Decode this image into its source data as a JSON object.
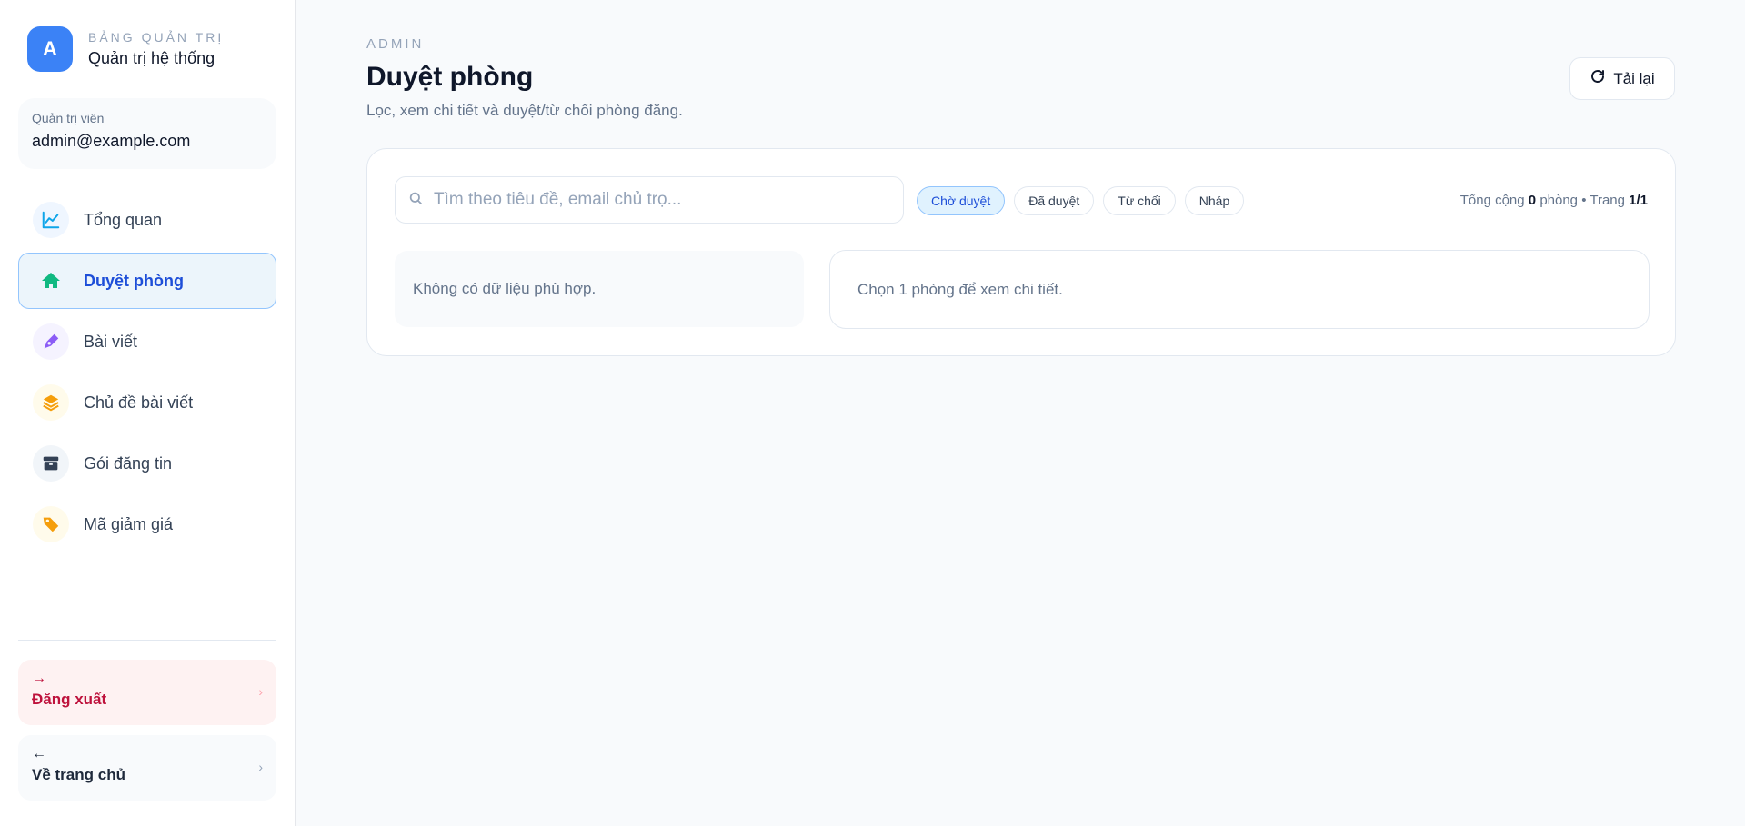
{
  "brand": {
    "avatar_letter": "A",
    "kicker": "BẢNG QUẢN TRỊ",
    "title": "Quản trị hệ thống"
  },
  "user": {
    "role": "Quản trị viên",
    "email": "admin@example.com"
  },
  "nav": [
    {
      "label": "Tổng quan",
      "icon": "chart-line-icon",
      "active": false
    },
    {
      "label": "Duyệt phòng",
      "icon": "home-icon",
      "active": true
    },
    {
      "label": "Bài viết",
      "icon": "pen-nib-icon",
      "active": false
    },
    {
      "label": "Chủ đề bài viết",
      "icon": "layers-icon",
      "active": false
    },
    {
      "label": "Gói đăng tin",
      "icon": "package-icon",
      "active": false
    },
    {
      "label": "Mã giảm giá",
      "icon": "tag-icon",
      "active": false
    }
  ],
  "bottom": {
    "logout": {
      "arrow": "→",
      "label": "Đăng xuất"
    },
    "home": {
      "arrow": "←",
      "label": "Về trang chủ"
    }
  },
  "header": {
    "kicker": "ADMIN",
    "title": "Duyệt phòng",
    "subtitle": "Lọc, xem chi tiết và duyệt/từ chối phòng đăng.",
    "reload_label": "Tải lại"
  },
  "filters": {
    "search_placeholder": "Tìm theo tiêu đề, email chủ trọ...",
    "search_value": "",
    "chips": [
      {
        "label": "Chờ duyệt",
        "active": true
      },
      {
        "label": "Đã duyệt",
        "active": false
      },
      {
        "label": "Từ chối",
        "active": false
      },
      {
        "label": "Nháp",
        "active": false
      }
    ],
    "summary": {
      "prefix": "Tổng cộng",
      "count": "0",
      "unit": "phòng • Trang",
      "page": "1/1"
    }
  },
  "content": {
    "empty_text": "Không có dữ liệu phù hợp.",
    "detail_placeholder": "Chọn 1 phòng để xem chi tiết."
  },
  "colors": {
    "accent": "#3b82f6",
    "active_text": "#1d4ed8",
    "danger": "#be123c"
  }
}
